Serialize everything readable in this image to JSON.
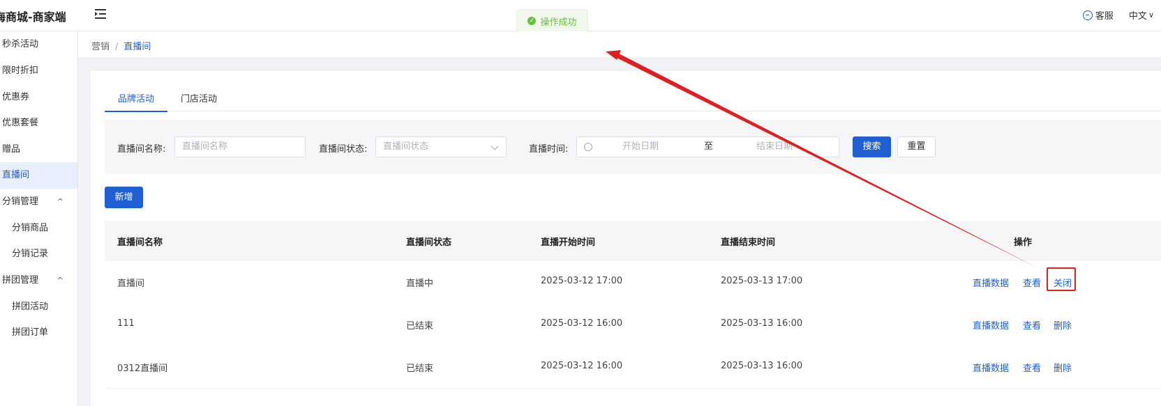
{
  "app": {
    "title": "海商城-商家端"
  },
  "header": {
    "customer_service": "客服",
    "language": "中文"
  },
  "toast": {
    "text": "操作成功"
  },
  "sidebar": {
    "items": [
      {
        "label": "秒杀活动"
      },
      {
        "label": "限时折扣"
      },
      {
        "label": "优惠券"
      },
      {
        "label": "优惠套餐"
      },
      {
        "label": "赠品"
      },
      {
        "label": "直播间"
      },
      {
        "label": "分销管理"
      },
      {
        "label": "分销商品"
      },
      {
        "label": "分销记录"
      },
      {
        "label": "拼团管理"
      },
      {
        "label": "拼团活动"
      },
      {
        "label": "拼团订单"
      }
    ]
  },
  "breadcrumb": {
    "parent": "营销",
    "separator": "/",
    "current": "直播间"
  },
  "tabs": [
    {
      "label": "品牌活动"
    },
    {
      "label": "门店活动"
    }
  ],
  "filter": {
    "name_label": "直播间名称:",
    "name_placeholder": "直播间名称",
    "status_label": "直播间状态:",
    "status_placeholder": "直播间状态",
    "time_label": "直播时间:",
    "start_placeholder": "开始日期",
    "range_sep": "至",
    "end_placeholder": "结束日期",
    "search_btn": "搜索",
    "reset_btn": "重置"
  },
  "actions": {
    "add_btn": "新增"
  },
  "table": {
    "columns": [
      "直播间名称",
      "直播间状态",
      "直播开始时间",
      "直播结束时间",
      "操作"
    ],
    "rows": [
      {
        "name": "直播间",
        "status": "直播中",
        "start": "2025-03-12 17:00",
        "end": "2025-03-13 17:00",
        "ops": [
          "直播数据",
          "查看",
          "关闭"
        ]
      },
      {
        "name": "111",
        "status": "已结束",
        "start": "2025-03-12 16:00",
        "end": "2025-03-13 16:00",
        "ops": [
          "直播数据",
          "查看",
          "删除"
        ]
      },
      {
        "name": "0312直播间",
        "status": "已结束",
        "start": "2025-03-12 16:00",
        "end": "2025-03-13 16:00",
        "ops": [
          "直播数据",
          "查看",
          "删除"
        ]
      }
    ]
  },
  "colors": {
    "primary": "#1f5fd3",
    "success": "#67c23a",
    "annotation": "#e02020"
  }
}
